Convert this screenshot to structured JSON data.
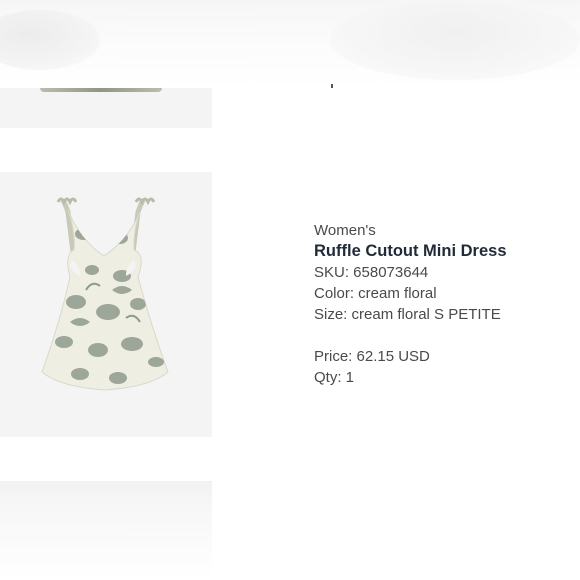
{
  "product": {
    "category": "Women's",
    "name": "Ruffle Cutout Mini Dress",
    "sku": "SKU: 658073644",
    "color": "Color: cream floral",
    "size": "Size: cream floral S PETITE",
    "price": "Price: 62.15 USD",
    "qty": "Qty: 1"
  },
  "colors": {
    "name_text": "#1f2b3b",
    "body_text": "#4a4a4a",
    "image_bg": "#f4f4f4",
    "dress_base": "#efeee2",
    "dress_print": "#8e9a8c"
  }
}
